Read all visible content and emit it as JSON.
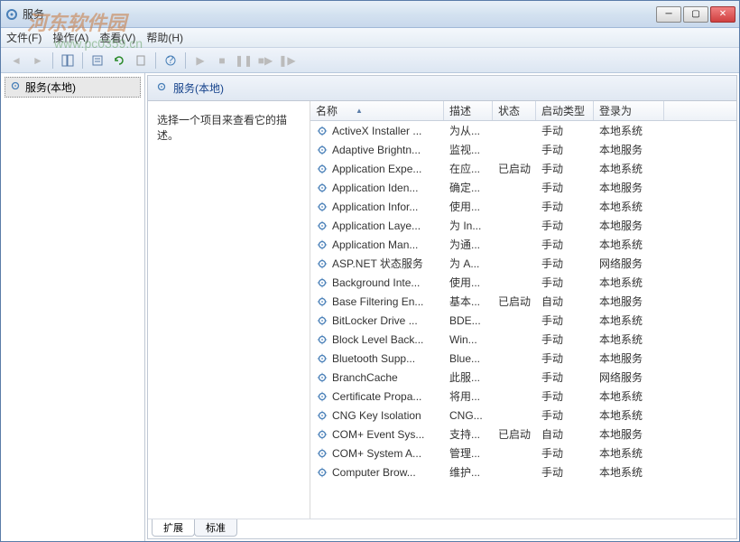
{
  "watermark": {
    "text": "河东软件园",
    "url": "www.pc0359.cn"
  },
  "window": {
    "title": "服务"
  },
  "menu": {
    "file": "文件(F)",
    "action": "操作(A)",
    "view": "查看(V)",
    "help": "帮助(H)"
  },
  "left": {
    "root": "服务(本地)"
  },
  "right": {
    "header": "服务(本地)",
    "desc_prompt": "选择一个项目来查看它的描述。",
    "columns": {
      "name": "名称",
      "desc": "描述",
      "status": "状态",
      "startup": "启动类型",
      "logon": "登录为"
    }
  },
  "tabs": {
    "extended": "扩展",
    "standard": "标准"
  },
  "services": [
    {
      "name": "ActiveX Installer ...",
      "desc": "为从...",
      "status": "",
      "startup": "手动",
      "logon": "本地系统"
    },
    {
      "name": "Adaptive Brightn...",
      "desc": "监视...",
      "status": "",
      "startup": "手动",
      "logon": "本地服务"
    },
    {
      "name": "Application Expe...",
      "desc": "在应...",
      "status": "已启动",
      "startup": "手动",
      "logon": "本地系统"
    },
    {
      "name": "Application Iden...",
      "desc": "确定...",
      "status": "",
      "startup": "手动",
      "logon": "本地服务"
    },
    {
      "name": "Application Infor...",
      "desc": "使用...",
      "status": "",
      "startup": "手动",
      "logon": "本地系统"
    },
    {
      "name": "Application Laye...",
      "desc": "为 In...",
      "status": "",
      "startup": "手动",
      "logon": "本地服务"
    },
    {
      "name": "Application Man...",
      "desc": "为通...",
      "status": "",
      "startup": "手动",
      "logon": "本地系统"
    },
    {
      "name": "ASP.NET 状态服务",
      "desc": "为 A...",
      "status": "",
      "startup": "手动",
      "logon": "网络服务"
    },
    {
      "name": "Background Inte...",
      "desc": "使用...",
      "status": "",
      "startup": "手动",
      "logon": "本地系统"
    },
    {
      "name": "Base Filtering En...",
      "desc": "基本...",
      "status": "已启动",
      "startup": "自动",
      "logon": "本地服务"
    },
    {
      "name": "BitLocker Drive ...",
      "desc": "BDE...",
      "status": "",
      "startup": "手动",
      "logon": "本地系统"
    },
    {
      "name": "Block Level Back...",
      "desc": "Win...",
      "status": "",
      "startup": "手动",
      "logon": "本地系统"
    },
    {
      "name": "Bluetooth Supp...",
      "desc": "Blue...",
      "status": "",
      "startup": "手动",
      "logon": "本地服务"
    },
    {
      "name": "BranchCache",
      "desc": "此服...",
      "status": "",
      "startup": "手动",
      "logon": "网络服务"
    },
    {
      "name": "Certificate Propa...",
      "desc": "将用...",
      "status": "",
      "startup": "手动",
      "logon": "本地系统"
    },
    {
      "name": "CNG Key Isolation",
      "desc": "CNG...",
      "status": "",
      "startup": "手动",
      "logon": "本地系统"
    },
    {
      "name": "COM+ Event Sys...",
      "desc": "支持...",
      "status": "已启动",
      "startup": "自动",
      "logon": "本地服务"
    },
    {
      "name": "COM+ System A...",
      "desc": "管理...",
      "status": "",
      "startup": "手动",
      "logon": "本地系统"
    },
    {
      "name": "Computer Brow...",
      "desc": "维护...",
      "status": "",
      "startup": "手动",
      "logon": "本地系统"
    }
  ]
}
